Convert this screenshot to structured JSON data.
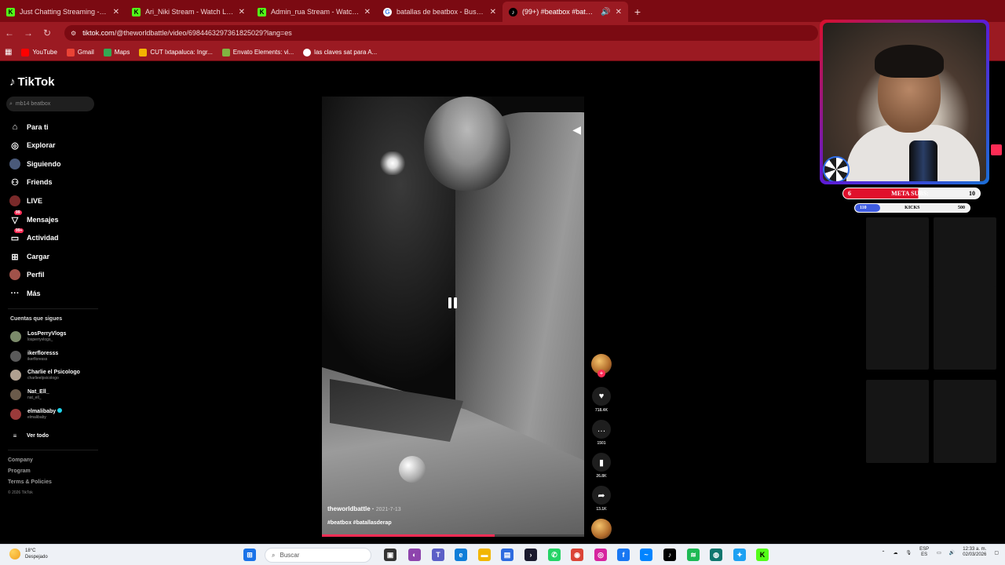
{
  "browser": {
    "tabs": [
      {
        "label": "Just Chatting Streaming - Live S",
        "favicon": "kick",
        "active": false
      },
      {
        "label": "Ari_Niki Stream - Watch Live on",
        "favicon": "kick",
        "active": false
      },
      {
        "label": "Admin_rua Stream - Watch Live",
        "favicon": "kick",
        "active": false
      },
      {
        "label": "batallas de beatbox - Buscar co",
        "favicon": "google",
        "active": false
      },
      {
        "label": "(99+) #beatbox #batallasde",
        "favicon": "tiktok",
        "active": true
      }
    ],
    "url_domain": "tiktok.com",
    "url_path": "/@theworldbattle/video/6984463297361825029?lang=es",
    "bookmarks": [
      {
        "label": "YouTube",
        "color": "#ff0000"
      },
      {
        "label": "Gmail",
        "color": "#ea4335"
      },
      {
        "label": "Maps",
        "color": "#34a853"
      },
      {
        "label": "CUT Ixtapaluca: Ingr...",
        "color": "#f4b400"
      },
      {
        "label": "Envato Elements: vi...",
        "color": "#81b441"
      },
      {
        "label": "las claves sat para A...",
        "color": "#ffffff"
      }
    ]
  },
  "tiktok": {
    "logo": "TikTok",
    "search_placeholder": "mb14 beatbox",
    "nav": [
      {
        "label": "Para ti",
        "icon": "home-icon"
      },
      {
        "label": "Explorar",
        "icon": "compass-icon"
      },
      {
        "label": "Siguiendo",
        "icon": "following-icon"
      },
      {
        "label": "Friends",
        "icon": "friends-icon"
      },
      {
        "label": "LIVE",
        "icon": "live-icon"
      },
      {
        "label": "Mensajes",
        "icon": "messages-icon",
        "badge": "99"
      },
      {
        "label": "Actividad",
        "icon": "activity-icon",
        "badge": "99+"
      },
      {
        "label": "Cargar",
        "icon": "upload-icon"
      },
      {
        "label": "Perfil",
        "icon": "profile-icon"
      },
      {
        "label": "Más",
        "icon": "more-icon"
      }
    ],
    "following_title": "Cuentas que sigues",
    "following": [
      {
        "name": "LosPerryVlogs",
        "handle": "losperryvlogs_",
        "verified": false
      },
      {
        "name": "ikerfloresss",
        "handle": "ikerfloresss",
        "verified": false
      },
      {
        "name": "Charlie el Psicologo",
        "handle": "charlieelpsicologo",
        "verified": false
      },
      {
        "name": "Nat_Ell_",
        "handle": "nat_ell_",
        "verified": false
      },
      {
        "name": "elmalibaby",
        "handle": "elmalibaby",
        "verified": true
      }
    ],
    "see_all": "Ver todo",
    "footer": [
      "Company",
      "Program",
      "Terms & Policies"
    ],
    "copyright": "© 2026 TikTok",
    "video": {
      "author": "theworldbattle",
      "date": "2021-7-13",
      "tags": "#beatbox #batallasderap",
      "progress": 0.66
    },
    "actions": {
      "likes": "718.4K",
      "comments": "1501",
      "saves": "26.8K",
      "shares": "13.1K"
    }
  },
  "stream_overlay": {
    "meta_left": "6",
    "meta_label": "META SUBS:",
    "meta_right": "10",
    "kicks_left": "110",
    "kicks_label": "KICKS",
    "kicks_right": "500",
    "kicks_progress": 0.22
  },
  "taskbar": {
    "weather_temp": "18°C",
    "weather_desc": "Despejado",
    "search_placeholder": "Buscar",
    "lang": "ESP",
    "lang_sub": "ES",
    "time": "12:33 a. m.",
    "date": "02/03/2026"
  }
}
